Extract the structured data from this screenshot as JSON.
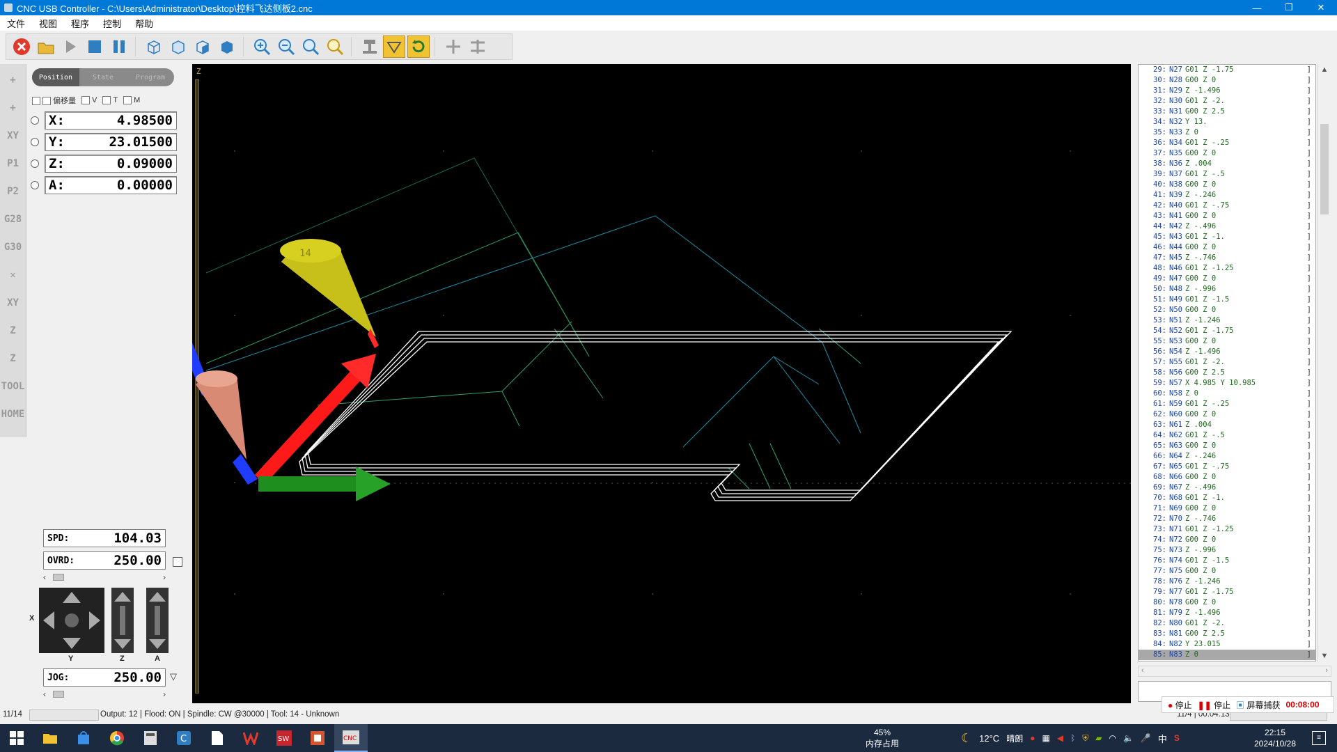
{
  "window": {
    "title": "CNC USB Controller - C:\\Users\\Administrator\\Desktop\\控料飞达侧板2.cnc",
    "minimize": "—",
    "restore": "❐",
    "close": "✕"
  },
  "menu": [
    "文件",
    "视图",
    "程序",
    "控制",
    "帮助"
  ],
  "left_strip": [
    "+",
    "+",
    "XY",
    "P1",
    "P2",
    "G28",
    "G30",
    "✕",
    "XY",
    "Z",
    "Z",
    "TOOL",
    "HOME"
  ],
  "position_panel": {
    "tabs": [
      "Position",
      "State",
      "Program"
    ],
    "checks": [
      "偏移量",
      "V",
      "T",
      "M"
    ],
    "axes": [
      {
        "label": "X:",
        "value": "4.98500"
      },
      {
        "label": "Y:",
        "value": "23.01500"
      },
      {
        "label": "Z:",
        "value": "0.09000"
      },
      {
        "label": "A:",
        "value": "0.00000"
      }
    ]
  },
  "viewport": {
    "axis_label": "Z",
    "tool_label": "14"
  },
  "controls": {
    "spd_label": "SPD:",
    "spd_value": "104.03",
    "ovrd_label": "OVRD:",
    "ovrd_value": "250.00",
    "jog_label": "JOG:",
    "jog_value": "250.00",
    "scroll_left": "‹",
    "scroll_right": "›",
    "axis_x": "X",
    "axis_y": "Y",
    "axis_z": "Z",
    "axis_a": "A"
  },
  "code_lines": [
    {
      "ln": "29:",
      "n": "N27",
      "c": "G01 Z -1.75"
    },
    {
      "ln": "30:",
      "n": "N28",
      "c": "G00 Z 0"
    },
    {
      "ln": "31:",
      "n": "N29",
      "c": "Z -1.496"
    },
    {
      "ln": "32:",
      "n": "N30",
      "c": "G01 Z -2."
    },
    {
      "ln": "33:",
      "n": "N31",
      "c": "G00 Z 2.5"
    },
    {
      "ln": "34:",
      "n": "N32",
      "c": "Y 13."
    },
    {
      "ln": "35:",
      "n": "N33",
      "c": "Z 0"
    },
    {
      "ln": "36:",
      "n": "N34",
      "c": "G01 Z -.25"
    },
    {
      "ln": "37:",
      "n": "N35",
      "c": "G00 Z 0"
    },
    {
      "ln": "38:",
      "n": "N36",
      "c": "Z .004"
    },
    {
      "ln": "39:",
      "n": "N37",
      "c": "G01 Z -.5"
    },
    {
      "ln": "40:",
      "n": "N38",
      "c": "G00 Z 0"
    },
    {
      "ln": "41:",
      "n": "N39",
      "c": "Z -.246"
    },
    {
      "ln": "42:",
      "n": "N40",
      "c": "G01 Z -.75"
    },
    {
      "ln": "43:",
      "n": "N41",
      "c": "G00 Z 0"
    },
    {
      "ln": "44:",
      "n": "N42",
      "c": "Z -.496"
    },
    {
      "ln": "45:",
      "n": "N43",
      "c": "G01 Z -1."
    },
    {
      "ln": "46:",
      "n": "N44",
      "c": "G00 Z 0"
    },
    {
      "ln": "47:",
      "n": "N45",
      "c": "Z -.746"
    },
    {
      "ln": "48:",
      "n": "N46",
      "c": "G01 Z -1.25"
    },
    {
      "ln": "49:",
      "n": "N47",
      "c": "G00 Z 0"
    },
    {
      "ln": "50:",
      "n": "N48",
      "c": "Z -.996"
    },
    {
      "ln": "51:",
      "n": "N49",
      "c": "G01 Z -1.5"
    },
    {
      "ln": "52:",
      "n": "N50",
      "c": "G00 Z 0"
    },
    {
      "ln": "53:",
      "n": "N51",
      "c": "Z -1.246"
    },
    {
      "ln": "54:",
      "n": "N52",
      "c": "G01 Z -1.75"
    },
    {
      "ln": "55:",
      "n": "N53",
      "c": "G00 Z 0"
    },
    {
      "ln": "56:",
      "n": "N54",
      "c": "Z -1.496"
    },
    {
      "ln": "57:",
      "n": "N55",
      "c": "G01 Z -2."
    },
    {
      "ln": "58:",
      "n": "N56",
      "c": "G00 Z 2.5"
    },
    {
      "ln": "59:",
      "n": "N57",
      "c": "X 4.985 Y 10.985"
    },
    {
      "ln": "60:",
      "n": "N58",
      "c": "Z 0"
    },
    {
      "ln": "61:",
      "n": "N59",
      "c": "G01 Z -.25"
    },
    {
      "ln": "62:",
      "n": "N60",
      "c": "G00 Z 0"
    },
    {
      "ln": "63:",
      "n": "N61",
      "c": "Z .004"
    },
    {
      "ln": "64:",
      "n": "N62",
      "c": "G01 Z -.5"
    },
    {
      "ln": "65:",
      "n": "N63",
      "c": "G00 Z 0"
    },
    {
      "ln": "66:",
      "n": "N64",
      "c": "Z -.246"
    },
    {
      "ln": "67:",
      "n": "N65",
      "c": "G01 Z -.75"
    },
    {
      "ln": "68:",
      "n": "N66",
      "c": "G00 Z 0"
    },
    {
      "ln": "69:",
      "n": "N67",
      "c": "Z -.496"
    },
    {
      "ln": "70:",
      "n": "N68",
      "c": "G01 Z -1."
    },
    {
      "ln": "71:",
      "n": "N69",
      "c": "G00 Z 0"
    },
    {
      "ln": "72:",
      "n": "N70",
      "c": "Z -.746"
    },
    {
      "ln": "73:",
      "n": "N71",
      "c": "G01 Z -1.25"
    },
    {
      "ln": "74:",
      "n": "N72",
      "c": "G00 Z 0"
    },
    {
      "ln": "75:",
      "n": "N73",
      "c": "Z -.996"
    },
    {
      "ln": "76:",
      "n": "N74",
      "c": "G01 Z -1.5"
    },
    {
      "ln": "77:",
      "n": "N75",
      "c": "G00 Z 0"
    },
    {
      "ln": "78:",
      "n": "N76",
      "c": "Z -1.246"
    },
    {
      "ln": "79:",
      "n": "N77",
      "c": "G01 Z -1.75"
    },
    {
      "ln": "80:",
      "n": "N78",
      "c": "G00 Z 0"
    },
    {
      "ln": "81:",
      "n": "N79",
      "c": "Z -1.496"
    },
    {
      "ln": "82:",
      "n": "N80",
      "c": "G01 Z -2."
    },
    {
      "ln": "83:",
      "n": "N81",
      "c": "G00 Z 2.5"
    },
    {
      "ln": "84:",
      "n": "N82",
      "c": "Y 23.015"
    },
    {
      "ln": "85:",
      "n": "N83",
      "c": "Z 0",
      "selected": true
    }
  ],
  "status": {
    "line_count": "11/14",
    "progress": 0.65,
    "text": "Output: 12 | Flood: ON | Spindle: CW @30000 | Tool: 14 - Unknown",
    "right_text": "11/4 | 00:04:13",
    "right_progress": 0.1
  },
  "recorder": {
    "stop1": "停止",
    "stop2": "停止",
    "capture": "屏幕捕获",
    "time": "00:08:00"
  },
  "taskbar": {
    "mem_pct": "45%",
    "mem_label": "内存占用",
    "temp": "12°C",
    "weather": "晴朗",
    "ime": "中",
    "time": "22:15",
    "date": "2024/10/28"
  },
  "colors": {
    "titlebar": "#0078d7",
    "viewport_bg": "#000000",
    "toolpath": "#ffffff",
    "x_axis": "#ff1a1a",
    "y_axis": "#1e8f1e",
    "z_axis": "#1f3cff",
    "tool": "#d8d020",
    "stock": "#2fa46a"
  }
}
